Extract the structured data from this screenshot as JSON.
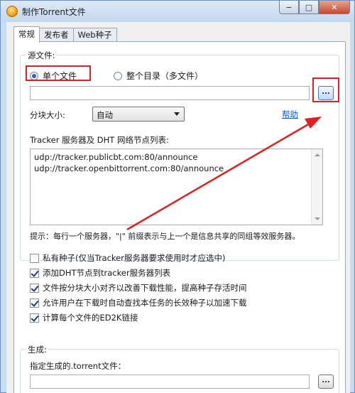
{
  "window": {
    "title": "制作Torrent文件",
    "min": "−",
    "max": "□",
    "close": "✕"
  },
  "tabs": [
    "常规",
    "发布者",
    "Web种子"
  ],
  "source": {
    "group_label": "源文件:",
    "single_file": "单个文件",
    "directory": "整个目录（多文件）",
    "browse": "...",
    "piece_size_label": "分块大小:",
    "piece_size_value": "自动",
    "help": "帮助"
  },
  "trackers": {
    "label": "Tracker 服务器及 DHT 网络节点列表:",
    "lines": [
      "udp://tracker.publicbt.com:80/announce",
      "udp://tracker.openbittorrent.com:80/announce"
    ],
    "hint": "提示：每行一个服务器，\"|\" 前缀表示与上一个是信息共享的同组等效服务器。"
  },
  "options": [
    {
      "label": "私有种子(仅当Tracker服务器要求使用时才应选中)",
      "checked": false
    },
    {
      "label": "添加DHT节点到tracker服务器列表",
      "checked": true
    },
    {
      "label": "文件按分块大小对齐以改善下载性能，提高种子存活时间",
      "checked": true
    },
    {
      "label": "允许用户在下载时自动查找本任务的长效种子以加速下载",
      "checked": true
    },
    {
      "label": "计算每个文件的ED2K链接",
      "checked": true
    }
  ],
  "generate": {
    "group_label": "生成:",
    "target_label": "指定生成的.torrent文件：",
    "browse": "..."
  },
  "annotation_color": "#e02020"
}
